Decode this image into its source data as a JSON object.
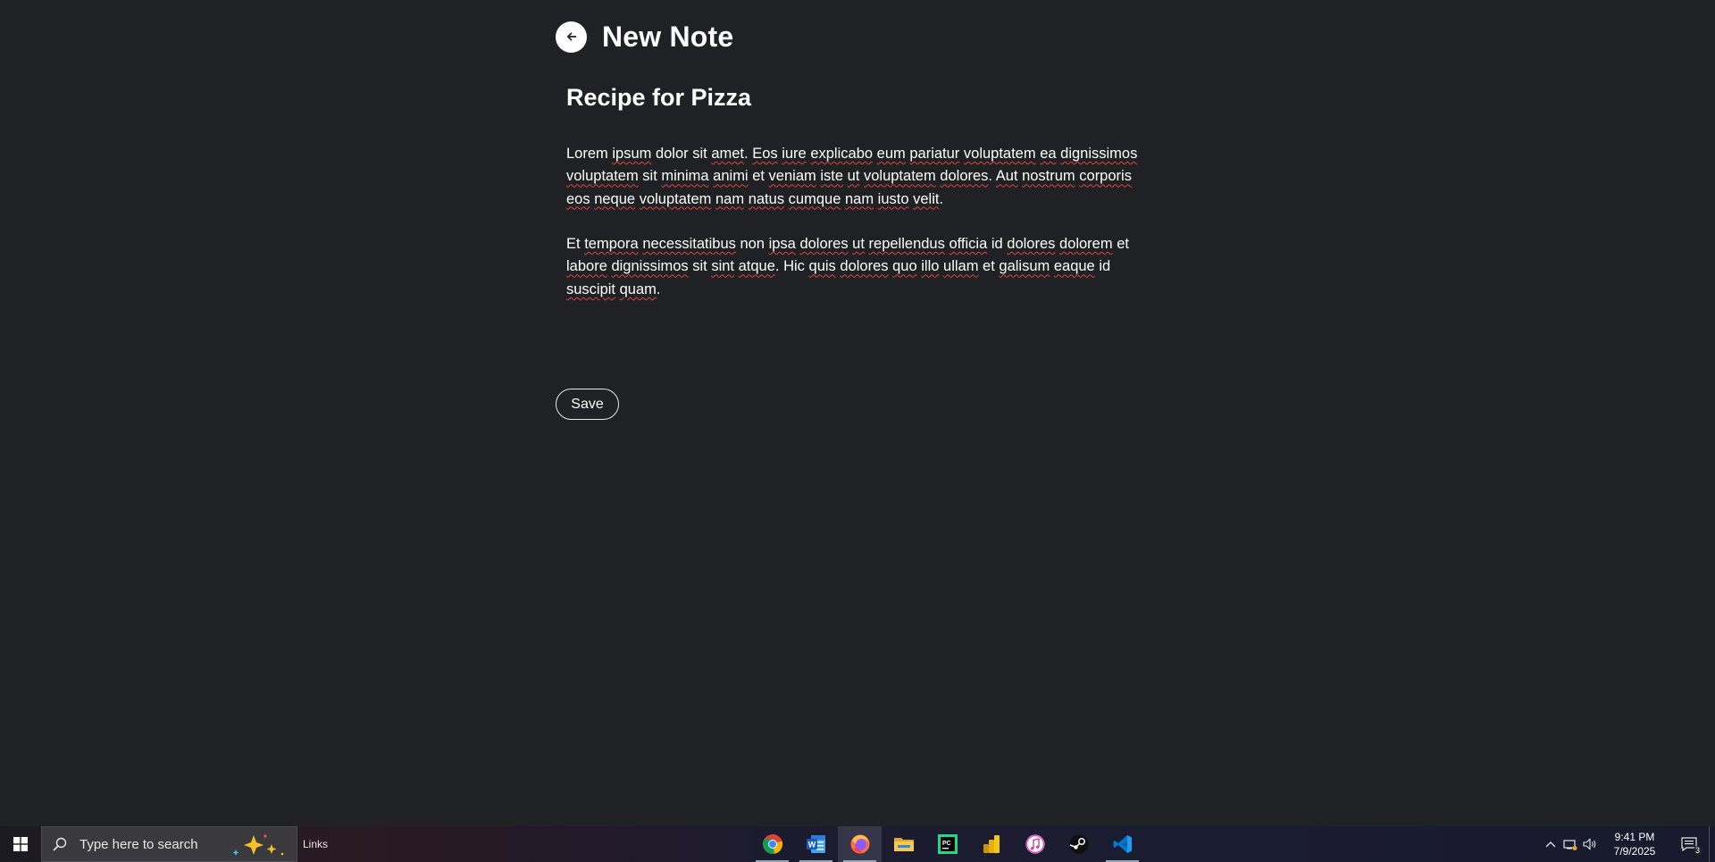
{
  "header": {
    "title": "New Note",
    "back_icon": "arrow-left-icon"
  },
  "note": {
    "title": "Recipe for Pizza",
    "paragraphs": [
      [
        {
          "t": "Lorem ",
          "s": false
        },
        {
          "t": "ipsum",
          "s": true
        },
        {
          "t": " dolor sit ",
          "s": false
        },
        {
          "t": "amet",
          "s": true
        },
        {
          "t": ". ",
          "s": false
        },
        {
          "t": "Eos",
          "s": true
        },
        {
          "t": " ",
          "s": false
        },
        {
          "t": "iure",
          "s": true
        },
        {
          "t": " ",
          "s": false
        },
        {
          "t": "explicabo",
          "s": true
        },
        {
          "t": " ",
          "s": false
        },
        {
          "t": "eum",
          "s": true
        },
        {
          "t": " ",
          "s": false
        },
        {
          "t": "pariatur",
          "s": true
        },
        {
          "t": " ",
          "s": false
        },
        {
          "t": "voluptatem",
          "s": true
        },
        {
          "t": " ",
          "s": false
        },
        {
          "t": "ea",
          "s": true
        },
        {
          "t": " ",
          "s": false
        },
        {
          "t": "dignissimos",
          "s": true
        },
        {
          "t": " ",
          "s": false
        },
        {
          "t": "voluptatem",
          "s": true
        },
        {
          "t": " sit ",
          "s": false
        },
        {
          "t": "minima",
          "s": true
        },
        {
          "t": " ",
          "s": false
        },
        {
          "t": "animi",
          "s": true
        },
        {
          "t": " et ",
          "s": false
        },
        {
          "t": "veniam",
          "s": true
        },
        {
          "t": " ",
          "s": false
        },
        {
          "t": "iste",
          "s": true
        },
        {
          "t": " ",
          "s": false
        },
        {
          "t": "ut",
          "s": true
        },
        {
          "t": " ",
          "s": false
        },
        {
          "t": "voluptatem",
          "s": true
        },
        {
          "t": " ",
          "s": false
        },
        {
          "t": "dolores",
          "s": true
        },
        {
          "t": ". ",
          "s": false
        },
        {
          "t": "Aut",
          "s": true
        },
        {
          "t": " ",
          "s": false
        },
        {
          "t": "nostrum",
          "s": true
        },
        {
          "t": " ",
          "s": false
        },
        {
          "t": "corporis",
          "s": true
        },
        {
          "t": " ",
          "s": false
        },
        {
          "t": "eos",
          "s": true
        },
        {
          "t": " ",
          "s": false
        },
        {
          "t": "neque",
          "s": true
        },
        {
          "t": " ",
          "s": false
        },
        {
          "t": "voluptatem",
          "s": true
        },
        {
          "t": " ",
          "s": false
        },
        {
          "t": "nam",
          "s": true
        },
        {
          "t": " ",
          "s": false
        },
        {
          "t": "natus",
          "s": true
        },
        {
          "t": " ",
          "s": false
        },
        {
          "t": "cumque",
          "s": true
        },
        {
          "t": " ",
          "s": false
        },
        {
          "t": "nam",
          "s": true
        },
        {
          "t": " ",
          "s": false
        },
        {
          "t": "iusto",
          "s": true
        },
        {
          "t": " ",
          "s": false
        },
        {
          "t": "velit",
          "s": true
        },
        {
          "t": ".",
          "s": false
        }
      ],
      [
        {
          "t": "Et ",
          "s": false
        },
        {
          "t": "tempora",
          "s": true
        },
        {
          "t": " ",
          "s": false
        },
        {
          "t": "necessitatibus",
          "s": true
        },
        {
          "t": " non ",
          "s": false
        },
        {
          "t": "ipsa",
          "s": true
        },
        {
          "t": " ",
          "s": false
        },
        {
          "t": "dolores",
          "s": true
        },
        {
          "t": " ",
          "s": false
        },
        {
          "t": "ut",
          "s": true
        },
        {
          "t": " ",
          "s": false
        },
        {
          "t": "repellendus",
          "s": true
        },
        {
          "t": " ",
          "s": false
        },
        {
          "t": "officia",
          "s": true
        },
        {
          "t": " id ",
          "s": false
        },
        {
          "t": "dolores",
          "s": true
        },
        {
          "t": " ",
          "s": false
        },
        {
          "t": "dolorem",
          "s": true
        },
        {
          "t": " et ",
          "s": false
        },
        {
          "t": "labore",
          "s": true
        },
        {
          "t": " ",
          "s": false
        },
        {
          "t": "dignissimos",
          "s": true
        },
        {
          "t": " sit ",
          "s": false
        },
        {
          "t": "sint",
          "s": true
        },
        {
          "t": " ",
          "s": false
        },
        {
          "t": "atque",
          "s": true
        },
        {
          "t": ". Hic ",
          "s": false
        },
        {
          "t": "quis",
          "s": true
        },
        {
          "t": " ",
          "s": false
        },
        {
          "t": "dolores",
          "s": true
        },
        {
          "t": " ",
          "s": false
        },
        {
          "t": "quo",
          "s": true
        },
        {
          "t": " ",
          "s": false
        },
        {
          "t": "illo",
          "s": true
        },
        {
          "t": " ",
          "s": false
        },
        {
          "t": "ullam",
          "s": true
        },
        {
          "t": " et ",
          "s": false
        },
        {
          "t": "galisum",
          "s": true
        },
        {
          "t": " ",
          "s": false
        },
        {
          "t": "eaque",
          "s": true
        },
        {
          "t": " id ",
          "s": false
        },
        {
          "t": "suscipit",
          "s": true
        },
        {
          "t": " ",
          "s": false
        },
        {
          "t": "quam",
          "s": true
        },
        {
          "t": ".",
          "s": false
        }
      ]
    ]
  },
  "actions": {
    "save_label": "Save"
  },
  "taskbar": {
    "start_icon": "windows-logo-icon",
    "search_placeholder": "Type here to search",
    "links_label": "Links",
    "apps": [
      {
        "name": "chrome-icon",
        "active": true
      },
      {
        "name": "word-icon",
        "active": true
      },
      {
        "name": "firefox-icon",
        "active": true,
        "focused": true
      },
      {
        "name": "file-explorer-icon",
        "active": false
      },
      {
        "name": "pycharm-icon",
        "active": false
      },
      {
        "name": "power-bi-icon",
        "active": false
      },
      {
        "name": "itunes-icon",
        "active": false
      },
      {
        "name": "steam-icon",
        "active": false
      },
      {
        "name": "vscode-icon",
        "active": true
      }
    ],
    "clock_time": "9:41 PM",
    "clock_date": "7/9/2025",
    "notification_count": "3"
  },
  "colors": {
    "background": "#202124",
    "spellcheck_underline": "#e0443b"
  }
}
